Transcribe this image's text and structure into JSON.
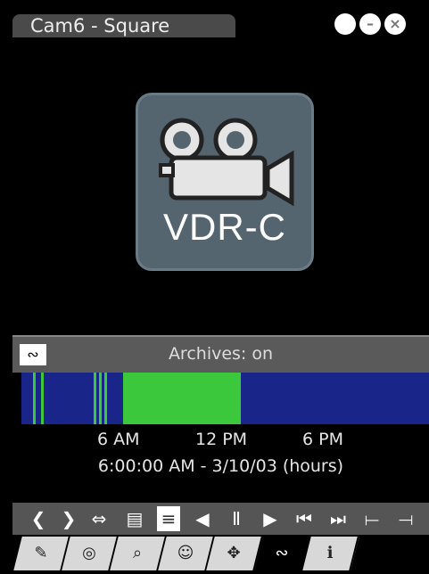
{
  "window": {
    "title": "Cam6 - Square",
    "buttons": [
      {
        "name": "restore-button",
        "glyph": ""
      },
      {
        "name": "minimize-button",
        "glyph": "–"
      },
      {
        "name": "close-button",
        "glyph": "×"
      }
    ]
  },
  "video": {
    "logo_text": "VDR-C"
  },
  "archives": {
    "header_icon": "∾",
    "status_text": "Archives: on",
    "timeline": {
      "colors": {
        "background": "#1a258a",
        "recorded": "#3cc83c"
      },
      "tick_labels": [
        "6 AM",
        "12 PM",
        "6 PM"
      ],
      "date_range": "6:00:00 AM - 3/10/03 (hours)"
    }
  },
  "controls": [
    {
      "name": "prev-button",
      "glyph": "❮"
    },
    {
      "name": "next-button",
      "glyph": "❯"
    },
    {
      "name": "expand-button",
      "glyph": "⇔"
    },
    {
      "name": "calendar-button",
      "glyph": "▤"
    },
    {
      "name": "list-button",
      "glyph": "≡",
      "active": true
    },
    {
      "name": "step-back-button",
      "glyph": "◀"
    },
    {
      "name": "pause-button",
      "glyph": "Ⅱ"
    },
    {
      "name": "play-button",
      "glyph": "▶"
    },
    {
      "name": "go-start-button",
      "glyph": "⏮"
    },
    {
      "name": "go-end-button",
      "glyph": "⏭"
    },
    {
      "name": "mark-in-button",
      "glyph": "⟝"
    },
    {
      "name": "mark-out-button",
      "glyph": "⟞"
    }
  ],
  "tabs": [
    {
      "name": "tab-edit",
      "glyph": "✎"
    },
    {
      "name": "tab-cameras",
      "glyph": "◎"
    },
    {
      "name": "tab-search",
      "glyph": "⌕"
    },
    {
      "name": "tab-users",
      "glyph": "☺"
    },
    {
      "name": "tab-ptz",
      "glyph": "✥"
    },
    {
      "name": "tab-archives",
      "glyph": "∾",
      "selected": true
    },
    {
      "name": "tab-info",
      "glyph": "ℹ"
    }
  ]
}
